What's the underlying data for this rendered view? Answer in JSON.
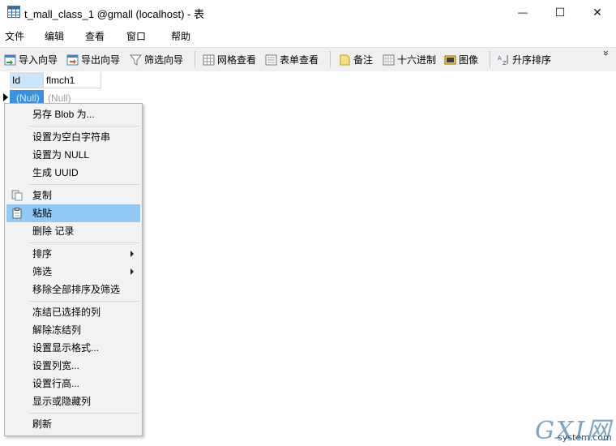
{
  "window": {
    "title": "t_mall_class_1 @gmall (localhost) - 表",
    "minimize": "—",
    "maximize": "☐",
    "close": "✕"
  },
  "menubar": {
    "items": [
      {
        "label": "文件"
      },
      {
        "label": "编辑"
      },
      {
        "label": "查看"
      },
      {
        "label": "窗口"
      },
      {
        "label": "帮助"
      }
    ]
  },
  "toolbar": {
    "import_wizard": "导入向导",
    "export_wizard": "导出向导",
    "filter_wizard": "筛选向导",
    "grid_view": "网格查看",
    "form_view": "表单查看",
    "memo": "备注",
    "hex": "十六进制",
    "image": "图像",
    "sort_asc": "升序排序",
    "more": "»"
  },
  "grid": {
    "columns": [
      "Id",
      "flmch1"
    ],
    "rows": [
      [
        "(Null)",
        "(Null)"
      ]
    ]
  },
  "context_menu": {
    "items": [
      {
        "label": "另存 Blob 为..."
      },
      {
        "label": "设置为空白字符串"
      },
      {
        "label": "设置为 NULL"
      },
      {
        "label": "生成 UUID"
      },
      {
        "label": "复制"
      },
      {
        "label": "粘贴"
      },
      {
        "label": "删除 记录"
      },
      {
        "label": "排序"
      },
      {
        "label": "筛选"
      },
      {
        "label": "移除全部排序及筛选"
      },
      {
        "label": "冻结已选择的列"
      },
      {
        "label": "解除冻结列"
      },
      {
        "label": "设置显示格式..."
      },
      {
        "label": "设置列宽..."
      },
      {
        "label": "设置行高..."
      },
      {
        "label": "显示或隐藏列"
      },
      {
        "label": "刷新"
      }
    ],
    "highlighted": "粘贴"
  },
  "watermark": {
    "main": "GXI网",
    "sub": "system.com"
  }
}
